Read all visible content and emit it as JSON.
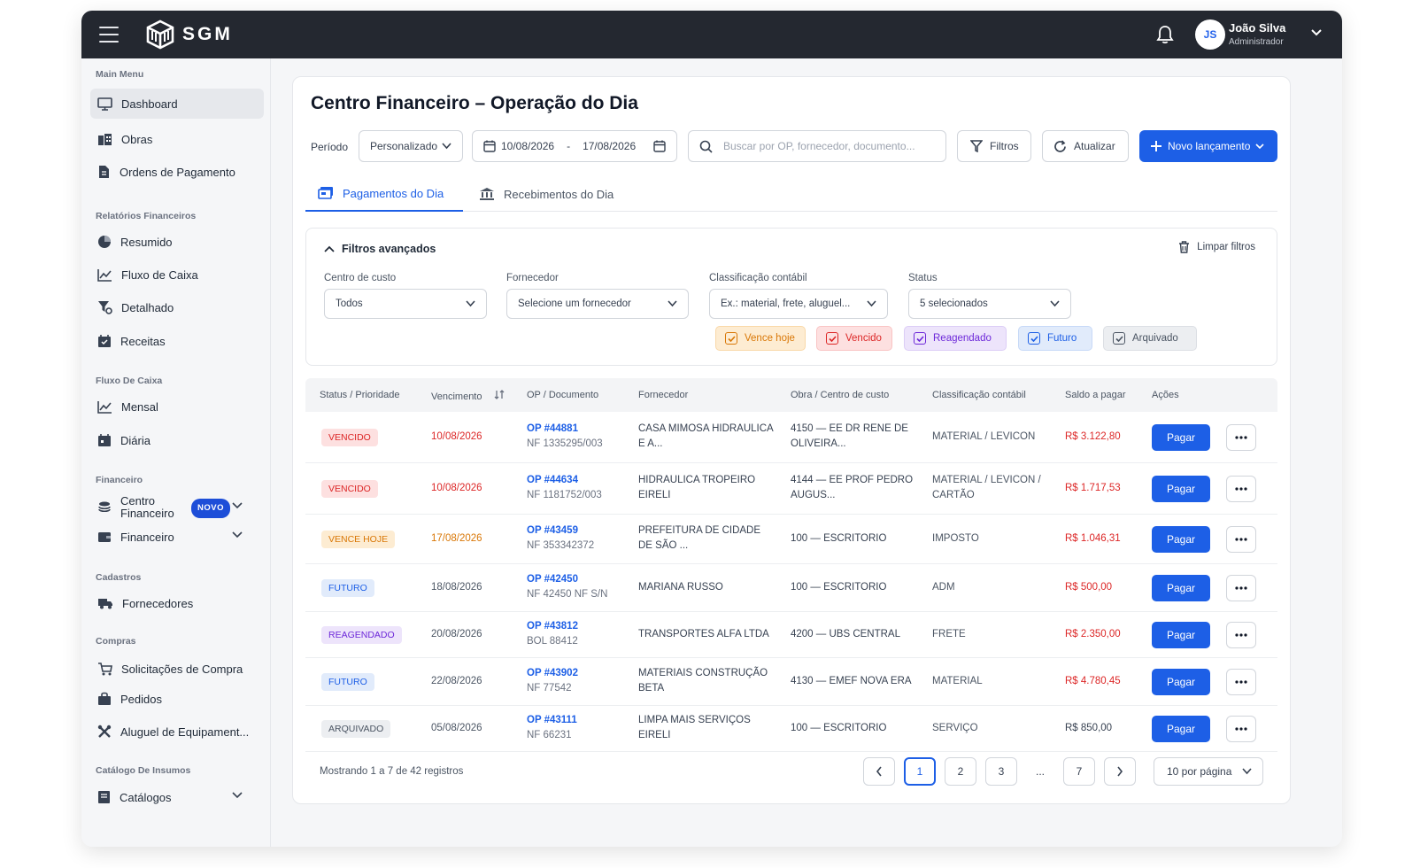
{
  "app": {
    "name": "SGM"
  },
  "user": {
    "name": "João Silva",
    "role": "Administrador",
    "initials": "JS"
  },
  "sidebar": {
    "sections": [
      {
        "title": "Main Menu"
      },
      {
        "title": "Relatórios Financeiros"
      },
      {
        "title": "Fluxo De Caixa"
      },
      {
        "title": "Financeiro"
      },
      {
        "title": "Cadastros"
      },
      {
        "title": "Compras"
      },
      {
        "title": "Catálogo De Insumos"
      }
    ],
    "items": [
      {
        "label": "Dashboard",
        "icon": "monitor-icon"
      },
      {
        "label": "Obras",
        "icon": "building-icon"
      },
      {
        "label": "Ordens de Pagamento",
        "icon": "document-icon"
      },
      {
        "label": "Resumido",
        "icon": "pie-chart-icon"
      },
      {
        "label": "Fluxo de Caixa",
        "icon": "line-chart-icon"
      },
      {
        "label": "Detalhado",
        "icon": "filter-settings-icon"
      },
      {
        "label": "Receitas",
        "icon": "calendar-check-icon"
      },
      {
        "label": "Mensal",
        "icon": "line-chart-icon"
      },
      {
        "label": "Diária",
        "icon": "calendar-icon"
      },
      {
        "label": "Centro Financeiro",
        "line1": "Centro",
        "line2": "Financeiro",
        "badge": "NOVO",
        "icon": "coins-icon"
      },
      {
        "label": "Financeiro",
        "icon": "wallet-icon"
      },
      {
        "label": "Fornecedores",
        "icon": "truck-icon"
      },
      {
        "label": "Solicitações de Compra",
        "icon": "cart-icon"
      },
      {
        "label": "Pedidos",
        "icon": "bag-icon"
      },
      {
        "label": "Aluguel de Equipament...",
        "icon": "tools-icon"
      },
      {
        "label": "Catálogos",
        "icon": "book-icon"
      }
    ]
  },
  "page": {
    "title": "Centro Financeiro – Operação do Dia",
    "periodo_label": "Período",
    "periodo_value": "Personalizado",
    "date_start": "10/08/2026",
    "date_sep": "-",
    "date_end": "17/08/2026",
    "search_placeholder": "Buscar por OP, fornecedor, documento...",
    "filtros_label": "Filtros",
    "atualizar_label": "Atualizar",
    "novo_label": "Novo lançamento"
  },
  "tabs": [
    {
      "label": "Pagamentos do Dia",
      "active": true
    },
    {
      "label": "Recebimentos do Dia",
      "active": false
    }
  ],
  "filters": {
    "title": "Filtros avançados",
    "clear_label": "Limpar filtros",
    "fields": [
      {
        "label": "Centro de custo",
        "value": "Todos"
      },
      {
        "label": "Fornecedor",
        "value": "Selecione um fornecedor"
      },
      {
        "label": "Classificação contábil",
        "value": "Ex.: material, frete, aluguel..."
      },
      {
        "label": "Status",
        "value": "5 selecionados"
      }
    ],
    "chips": [
      {
        "label": "Vence hoje",
        "color": "#d97706",
        "bg": "#fdecd2"
      },
      {
        "label": "Vencido",
        "color": "#dc2626",
        "bg": "#fde0e0"
      },
      {
        "label": "Reagendado",
        "color": "#6d28d9",
        "bg": "#ede4fb"
      },
      {
        "label": "Futuro",
        "color": "#1d5fe6",
        "bg": "#e1ebfb"
      },
      {
        "label": "Arquivado",
        "color": "#4b5563",
        "bg": "#eceef1"
      }
    ]
  },
  "table": {
    "headers": [
      "Status / Prioridade",
      "Vencimento",
      "OP / Documento",
      "Fornecedor",
      "Obra / Centro de custo",
      "Classificação contábil",
      "Saldo a pagar",
      "Ações"
    ],
    "pay_label": "Pagar",
    "rows": [
      {
        "status": "VENCIDO",
        "due": "10/08/2026",
        "op": "OP #44881",
        "doc": "NF 1335295/003",
        "supplier1": "CASA MIMOSA HIDRAULICA",
        "supplier2": "E A...",
        "obra1": "4150 — EE DR RENE DE",
        "obra2": "OLIVEIRA...",
        "class1": "MATERIAL / LEVICON",
        "class2": "",
        "amount": "R$ 3.122,80"
      },
      {
        "status": "VENCIDO",
        "due": "10/08/2026",
        "op": "OP #44634",
        "doc": "NF 1181752/003",
        "supplier1": "HIDRAULICA TROPEIRO",
        "supplier2": "EIRELI",
        "obra1": "4144 — EE PROF PEDRO",
        "obra2": "AUGUS...",
        "class1": "MATERIAL / LEVICON /",
        "class2": "CARTÃO",
        "amount": "R$ 1.717,53"
      },
      {
        "status": "VENCE HOJE",
        "due": "17/08/2026",
        "op": "OP #43459",
        "doc": "NF 353342372",
        "supplier1": "PREFEITURA DE CIDADE",
        "supplier2": "DE SÃO ...",
        "obra1": "100 — ESCRITORIO",
        "obra2": "",
        "class1": "IMPOSTO",
        "class2": "",
        "amount": "R$ 1.046,31"
      },
      {
        "status": "FUTURO",
        "due": "18/08/2026",
        "op": "OP #42450",
        "doc": "NF 42450 NF S/N",
        "supplier1": "MARIANA RUSSO",
        "supplier2": "",
        "obra1": "100 — ESCRITORIO",
        "obra2": "",
        "class1": "ADM",
        "class2": "",
        "amount": "R$ 500,00"
      },
      {
        "status": "REAGENDADO",
        "due": "20/08/2026",
        "op": "OP #43812",
        "doc": "BOL 88412",
        "supplier1": "TRANSPORTES ALFA LTDA",
        "supplier2": "",
        "obra1": "4200 — UBS CENTRAL",
        "obra2": "",
        "class1": "FRETE",
        "class2": "",
        "amount": "R$ 2.350,00"
      },
      {
        "status": "FUTURO",
        "due": "22/08/2026",
        "op": "OP #43902",
        "doc": "NF 77542",
        "supplier1": "MATERIAIS CONSTRUÇÃO",
        "supplier2": "BETA",
        "obra1": "4130 — EMEF NOVA ERA",
        "obra2": "",
        "class1": "MATERIAL",
        "class2": "",
        "amount": "R$ 4.780,45"
      },
      {
        "status": "ARQUIVADO",
        "due": "05/08/2026",
        "op": "OP #43111",
        "doc": "NF 66231",
        "supplier1": "LIMPA MAIS SERVIÇOS",
        "supplier2": "EIRELI",
        "obra1": "100 — ESCRITORIO",
        "obra2": "",
        "class1": "SERVIÇO",
        "class2": "",
        "amount": "R$ 850,00"
      }
    ]
  },
  "pagination": {
    "info": "Mostrando 1 a 7 de 42 registros",
    "pages": [
      "1",
      "2",
      "3",
      "...",
      "7"
    ],
    "per_page": "10 por página"
  },
  "colors": {
    "accent": "#1d5fe6",
    "topbar": "#242830",
    "danger": "#dc2626",
    "warning": "#d97706"
  }
}
